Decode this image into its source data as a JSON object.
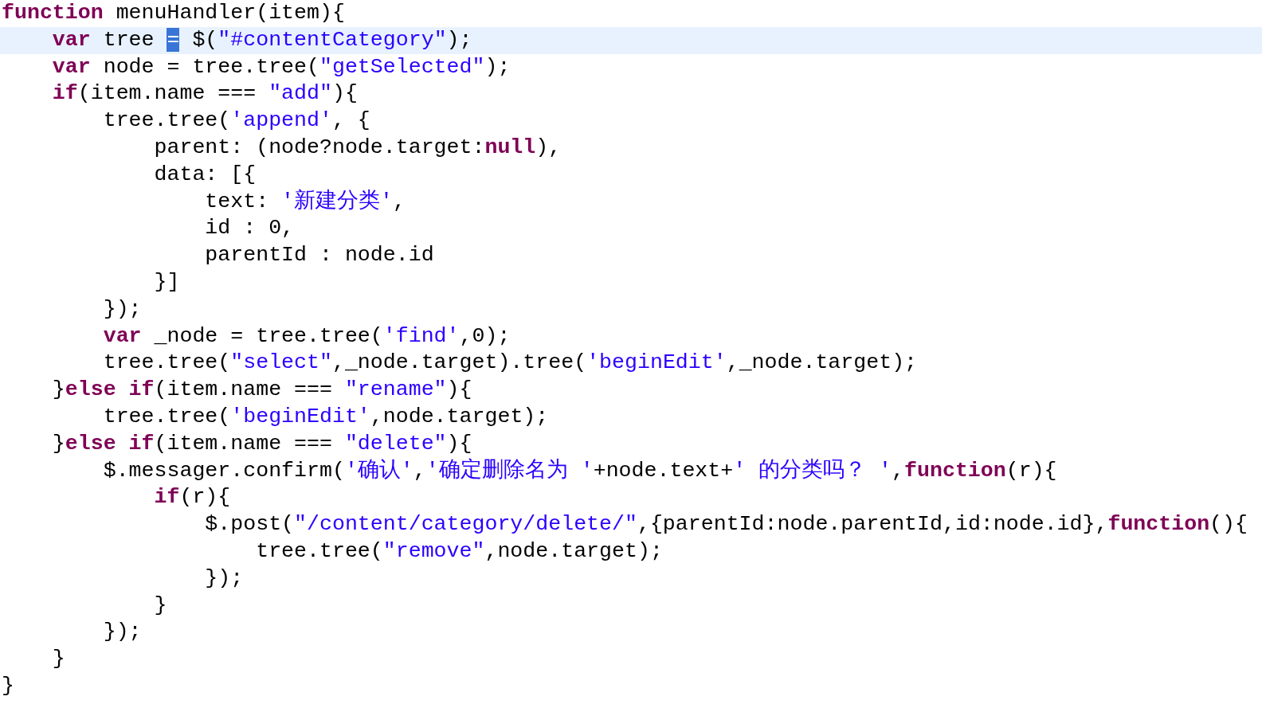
{
  "editor": {
    "lines": [
      {
        "current": false,
        "tokens": [
          {
            "kind": "keyword",
            "text": "function"
          },
          {
            "kind": "plain",
            "text": " menuHandler(item){"
          }
        ]
      },
      {
        "current": true,
        "tokens": [
          {
            "kind": "keyword",
            "text": "    var"
          },
          {
            "kind": "plain",
            "text": " tree "
          },
          {
            "kind": "selected",
            "text": "="
          },
          {
            "kind": "plain",
            "text": " $("
          },
          {
            "kind": "string",
            "text": "\"#contentCategory\""
          },
          {
            "kind": "plain",
            "text": ");"
          }
        ]
      },
      {
        "current": false,
        "tokens": [
          {
            "kind": "keyword",
            "text": "    var"
          },
          {
            "kind": "plain",
            "text": " node = tree.tree("
          },
          {
            "kind": "string",
            "text": "\"getSelected\""
          },
          {
            "kind": "plain",
            "text": ");"
          }
        ]
      },
      {
        "current": false,
        "tokens": [
          {
            "kind": "keyword",
            "text": "    if"
          },
          {
            "kind": "plain",
            "text": "(item.name === "
          },
          {
            "kind": "string",
            "text": "\"add\""
          },
          {
            "kind": "plain",
            "text": "){"
          }
        ]
      },
      {
        "current": false,
        "tokens": [
          {
            "kind": "plain",
            "text": "        tree.tree("
          },
          {
            "kind": "string",
            "text": "'append'"
          },
          {
            "kind": "plain",
            "text": ", {"
          }
        ]
      },
      {
        "current": false,
        "tokens": [
          {
            "kind": "plain",
            "text": "            parent: (node?node.target:"
          },
          {
            "kind": "keyword",
            "text": "null"
          },
          {
            "kind": "plain",
            "text": "),"
          }
        ]
      },
      {
        "current": false,
        "tokens": [
          {
            "kind": "plain",
            "text": "            data: [{"
          }
        ]
      },
      {
        "current": false,
        "tokens": [
          {
            "kind": "plain",
            "text": "                text: "
          },
          {
            "kind": "string",
            "text": "'新建分类'"
          },
          {
            "kind": "plain",
            "text": ","
          }
        ]
      },
      {
        "current": false,
        "tokens": [
          {
            "kind": "plain",
            "text": "                id : 0,"
          }
        ]
      },
      {
        "current": false,
        "tokens": [
          {
            "kind": "plain",
            "text": "                parentId : node.id"
          }
        ]
      },
      {
        "current": false,
        "tokens": [
          {
            "kind": "plain",
            "text": "            }]"
          }
        ]
      },
      {
        "current": false,
        "tokens": [
          {
            "kind": "plain",
            "text": "        });"
          }
        ]
      },
      {
        "current": false,
        "tokens": [
          {
            "kind": "keyword",
            "text": "        var"
          },
          {
            "kind": "plain",
            "text": " _node = tree.tree("
          },
          {
            "kind": "string",
            "text": "'find'"
          },
          {
            "kind": "plain",
            "text": ",0);"
          }
        ]
      },
      {
        "current": false,
        "tokens": [
          {
            "kind": "plain",
            "text": "        tree.tree("
          },
          {
            "kind": "string",
            "text": "\"select\""
          },
          {
            "kind": "plain",
            "text": ",_node.target).tree("
          },
          {
            "kind": "string",
            "text": "'beginEdit'"
          },
          {
            "kind": "plain",
            "text": ",_node.target);"
          }
        ]
      },
      {
        "current": false,
        "tokens": [
          {
            "kind": "plain",
            "text": "    }"
          },
          {
            "kind": "keyword",
            "text": "else if"
          },
          {
            "kind": "plain",
            "text": "(item.name === "
          },
          {
            "kind": "string",
            "text": "\"rename\""
          },
          {
            "kind": "plain",
            "text": "){"
          }
        ]
      },
      {
        "current": false,
        "tokens": [
          {
            "kind": "plain",
            "text": "        tree.tree("
          },
          {
            "kind": "string",
            "text": "'beginEdit'"
          },
          {
            "kind": "plain",
            "text": ",node.target);"
          }
        ]
      },
      {
        "current": false,
        "tokens": [
          {
            "kind": "plain",
            "text": "    }"
          },
          {
            "kind": "keyword",
            "text": "else if"
          },
          {
            "kind": "plain",
            "text": "(item.name === "
          },
          {
            "kind": "string",
            "text": "\"delete\""
          },
          {
            "kind": "plain",
            "text": "){"
          }
        ]
      },
      {
        "current": false,
        "tokens": [
          {
            "kind": "plain",
            "text": "        $.messager.confirm("
          },
          {
            "kind": "string",
            "text": "'确认'"
          },
          {
            "kind": "plain",
            "text": ","
          },
          {
            "kind": "string",
            "text": "'确定删除名为 '"
          },
          {
            "kind": "plain",
            "text": "+node.text+"
          },
          {
            "kind": "string",
            "text": "' 的分类吗？ '"
          },
          {
            "kind": "plain",
            "text": ","
          },
          {
            "kind": "keyword",
            "text": "function"
          },
          {
            "kind": "plain",
            "text": "(r){"
          }
        ]
      },
      {
        "current": false,
        "tokens": [
          {
            "kind": "keyword",
            "text": "            if"
          },
          {
            "kind": "plain",
            "text": "(r){"
          }
        ]
      },
      {
        "current": false,
        "tokens": [
          {
            "kind": "plain",
            "text": "                $.post("
          },
          {
            "kind": "string",
            "text": "\"/content/category/delete/\""
          },
          {
            "kind": "plain",
            "text": ",{parentId:node.parentId,id:node.id},"
          },
          {
            "kind": "keyword",
            "text": "function"
          },
          {
            "kind": "plain",
            "text": "(){"
          }
        ]
      },
      {
        "current": false,
        "tokens": [
          {
            "kind": "plain",
            "text": "                    tree.tree("
          },
          {
            "kind": "string",
            "text": "\"remove\""
          },
          {
            "kind": "plain",
            "text": ",node.target);"
          }
        ]
      },
      {
        "current": false,
        "tokens": [
          {
            "kind": "plain",
            "text": "                });"
          }
        ]
      },
      {
        "current": false,
        "tokens": [
          {
            "kind": "plain",
            "text": "            }"
          }
        ]
      },
      {
        "current": false,
        "tokens": [
          {
            "kind": "plain",
            "text": "        });"
          }
        ]
      },
      {
        "current": false,
        "tokens": [
          {
            "kind": "plain",
            "text": "    }"
          }
        ]
      },
      {
        "current": false,
        "tokens": [
          {
            "kind": "plain",
            "text": "}"
          }
        ]
      }
    ]
  }
}
